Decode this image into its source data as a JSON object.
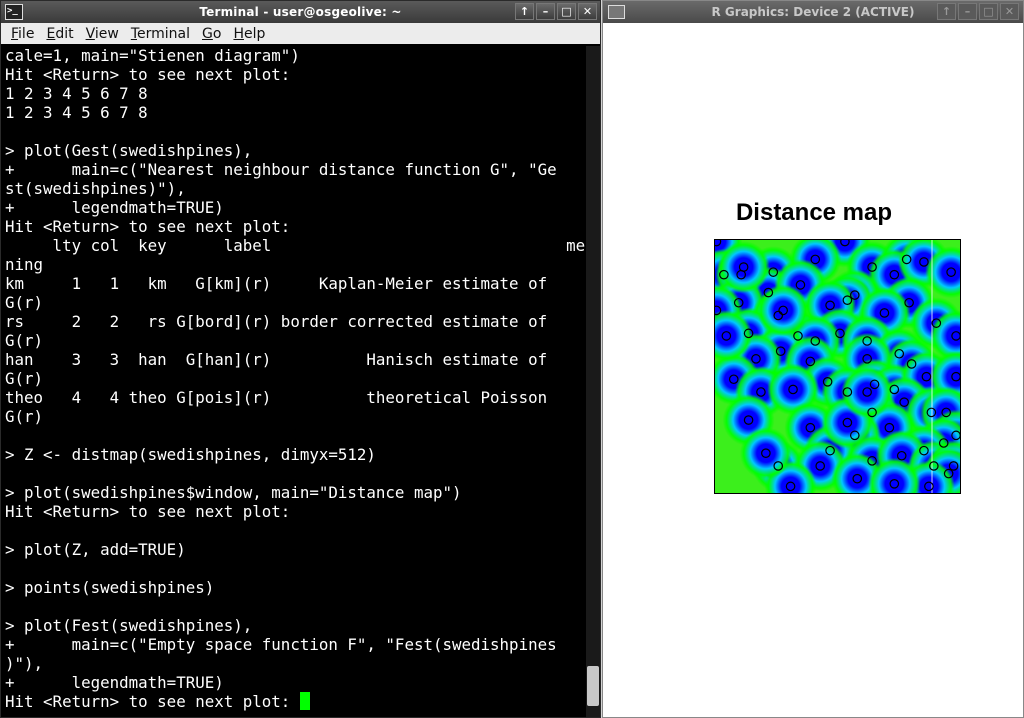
{
  "terminal": {
    "title": "Terminal - user@osgeolive: ~",
    "controls": [
      "↑",
      "–",
      "□",
      "✕"
    ],
    "menu": [
      {
        "label": "File",
        "u": "F",
        "rest": "ile"
      },
      {
        "label": "Edit",
        "u": "E",
        "rest": "dit"
      },
      {
        "label": "View",
        "u": "V",
        "rest": "iew"
      },
      {
        "label": "Terminal",
        "u": "T",
        "rest": "erminal"
      },
      {
        "label": "Go",
        "u": "G",
        "rest": "o"
      },
      {
        "label": "Help",
        "u": "H",
        "rest": "elp"
      }
    ],
    "lines": [
      "cale=1, main=\"Stienen diagram\")",
      "Hit <Return> to see next plot:",
      "1 2 3 4 5 6 7 8",
      "1 2 3 4 5 6 7 8",
      "",
      "> plot(Gest(swedishpines),",
      "+      main=c(\"Nearest neighbour distance function G\", \"Ge",
      "st(swedishpines)\"),",
      "+      legendmath=TRUE)",
      "Hit <Return> to see next plot:",
      "     lty col  key      label                               mea",
      "ning",
      "km     1   1   km   G[km](r)     Kaplan-Meier estimate of",
      "G(r)",
      "rs     2   2   rs G[bord](r) border corrected estimate of",
      "G(r)",
      "han    3   3  han  G[han](r)          Hanisch estimate of",
      "G(r)",
      "theo   4   4 theo G[pois](r)          theoretical Poisson",
      "G(r)",
      "",
      "> Z <- distmap(swedishpines, dimyx=512)",
      "",
      "> plot(swedishpines$window, main=\"Distance map\")",
      "Hit <Return> to see next plot:",
      "",
      "> plot(Z, add=TRUE)",
      "",
      "> points(swedishpines)",
      "",
      "> plot(Fest(swedishpines),",
      "+      main=c(\"Empty space function F\", \"Fest(swedishpines",
      ")\"),",
      "+      legendmath=TRUE)",
      "Hit <Return> to see next plot: "
    ]
  },
  "rgraphics": {
    "title": "R Graphics: Device 2 (ACTIVE)",
    "controls": [
      "↑",
      "–",
      "□",
      "✕"
    ],
    "plot_title": "Distance map",
    "points": [
      [
        0.01,
        0.99
      ],
      [
        0.53,
        0.99
      ],
      [
        0.04,
        0.86
      ],
      [
        0.11,
        0.86
      ],
      [
        0.24,
        0.87
      ],
      [
        0.41,
        0.92
      ],
      [
        0.64,
        0.89
      ],
      [
        0.78,
        0.92
      ],
      [
        0.73,
        0.86
      ],
      [
        0.85,
        0.91
      ],
      [
        0.96,
        0.87
      ],
      [
        0.22,
        0.79
      ],
      [
        0.35,
        0.82
      ],
      [
        0.57,
        0.78
      ],
      [
        0.54,
        0.76
      ],
      [
        0.47,
        0.74
      ],
      [
        0.1,
        0.75
      ],
      [
        0.01,
        0.72
      ],
      [
        0.79,
        0.75
      ],
      [
        0.26,
        0.7
      ],
      [
        0.69,
        0.71
      ],
      [
        0.9,
        0.67
      ],
      [
        0.14,
        0.63
      ],
      [
        0.34,
        0.62
      ],
      [
        0.51,
        0.63
      ],
      [
        0.41,
        0.6
      ],
      [
        0.62,
        0.6
      ],
      [
        0.75,
        0.55
      ],
      [
        0.98,
        0.62
      ],
      [
        0.27,
        0.56
      ],
      [
        0.17,
        0.53
      ],
      [
        0.39,
        0.52
      ],
      [
        0.62,
        0.53
      ],
      [
        0.8,
        0.51
      ],
      [
        0.08,
        0.45
      ],
      [
        0.46,
        0.44
      ],
      [
        0.65,
        0.43
      ],
      [
        0.73,
        0.41
      ],
      [
        0.19,
        0.4
      ],
      [
        0.32,
        0.41
      ],
      [
        0.86,
        0.46
      ],
      [
        0.98,
        0.46
      ],
      [
        0.54,
        0.4
      ],
      [
        0.77,
        0.36
      ],
      [
        0.64,
        0.32
      ],
      [
        0.88,
        0.32
      ],
      [
        0.71,
        0.26
      ],
      [
        0.94,
        0.32
      ],
      [
        0.39,
        0.26
      ],
      [
        0.57,
        0.23
      ],
      [
        0.14,
        0.29
      ],
      [
        0.98,
        0.23
      ],
      [
        0.47,
        0.17
      ],
      [
        0.93,
        0.2
      ],
      [
        0.64,
        0.13
      ],
      [
        0.85,
        0.17
      ],
      [
        0.26,
        0.11
      ],
      [
        0.43,
        0.11
      ],
      [
        0.76,
        0.15
      ],
      [
        0.58,
        0.06
      ],
      [
        0.89,
        0.11
      ],
      [
        0.97,
        0.11
      ],
      [
        0.95,
        0.08
      ],
      [
        0.87,
        0.03
      ],
      [
        0.73,
        0.04
      ],
      [
        0.31,
        0.03
      ],
      [
        0.21,
        0.16
      ],
      [
        0.12,
        0.89
      ],
      [
        0.54,
        0.28
      ],
      [
        0.62,
        0.4
      ],
      [
        0.28,
        0.72
      ],
      [
        0.05,
        0.62
      ]
    ],
    "colors": {
      "near": "#0000ff",
      "mid": "#00c8ff",
      "far": "#00ff00",
      "farthest": "#f0c070"
    }
  }
}
